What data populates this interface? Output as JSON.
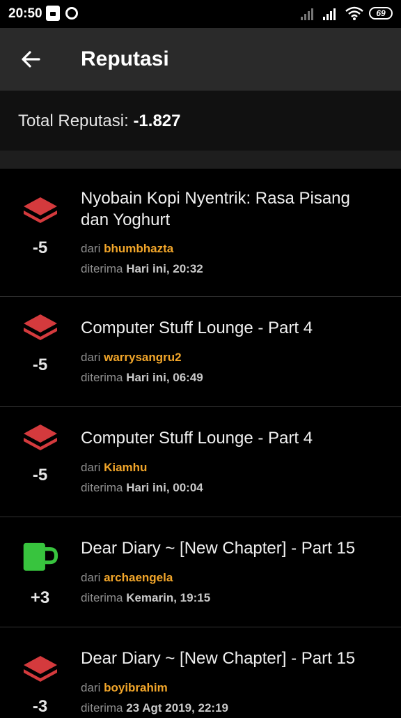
{
  "status_bar": {
    "time": "20:50",
    "battery": "69"
  },
  "app_bar": {
    "title": "Reputasi"
  },
  "summary": {
    "label": "Total Reputasi:",
    "value": "-1.827"
  },
  "colors": {
    "negative": "#d43a3d",
    "positive": "#38c43e",
    "username": "#f2a62a"
  },
  "items": [
    {
      "icon": "layers-icon",
      "score": "-5",
      "title": "Nyobain Kopi Nyentrik: Rasa Pisang dan Yoghurt",
      "from_label": "dari",
      "user": "bhumbhazta",
      "received_label": "diterima",
      "when": "Hari ini, 20:32"
    },
    {
      "icon": "layers-icon",
      "score": "-5",
      "title": "Computer Stuff Lounge - Part 4",
      "from_label": "dari",
      "user": "warrysangru2",
      "received_label": "diterima",
      "when": "Hari ini, 06:49"
    },
    {
      "icon": "layers-icon",
      "score": "-5",
      "title": "Computer Stuff Lounge - Part 4",
      "from_label": "dari",
      "user": "Kiamhu",
      "received_label": "diterima",
      "when": "Hari ini, 00:04"
    },
    {
      "icon": "mug-icon",
      "score": "+3",
      "title": "Dear Diary ~ [New Chapter] - Part 15",
      "from_label": "dari",
      "user": "archaengela",
      "received_label": "diterima",
      "when": "Kemarin, 19:15"
    },
    {
      "icon": "layers-icon",
      "score": "-3",
      "title": "Dear Diary ~ [New Chapter] - Part 15",
      "from_label": "dari",
      "user": "boyibrahim",
      "received_label": "diterima",
      "when": "23 Agt 2019, 22:19"
    }
  ]
}
